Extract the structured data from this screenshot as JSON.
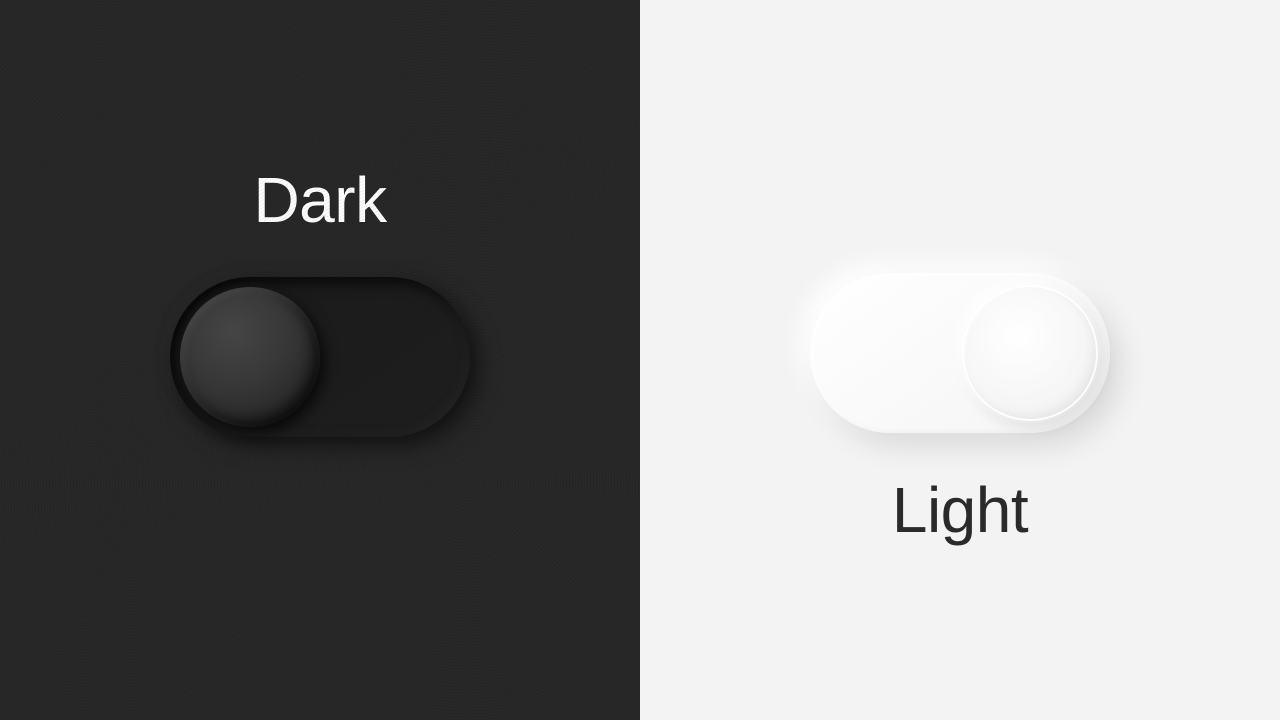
{
  "panels": {
    "dark": {
      "label": "Dark",
      "bg_color": "#272727",
      "text_color": "#ffffff",
      "toggle_state": "off",
      "knob_position": "left"
    },
    "light": {
      "label": "Light",
      "bg_color": "#f3f3f3",
      "text_color": "#2a2a2a",
      "toggle_state": "on",
      "knob_position": "right"
    }
  }
}
